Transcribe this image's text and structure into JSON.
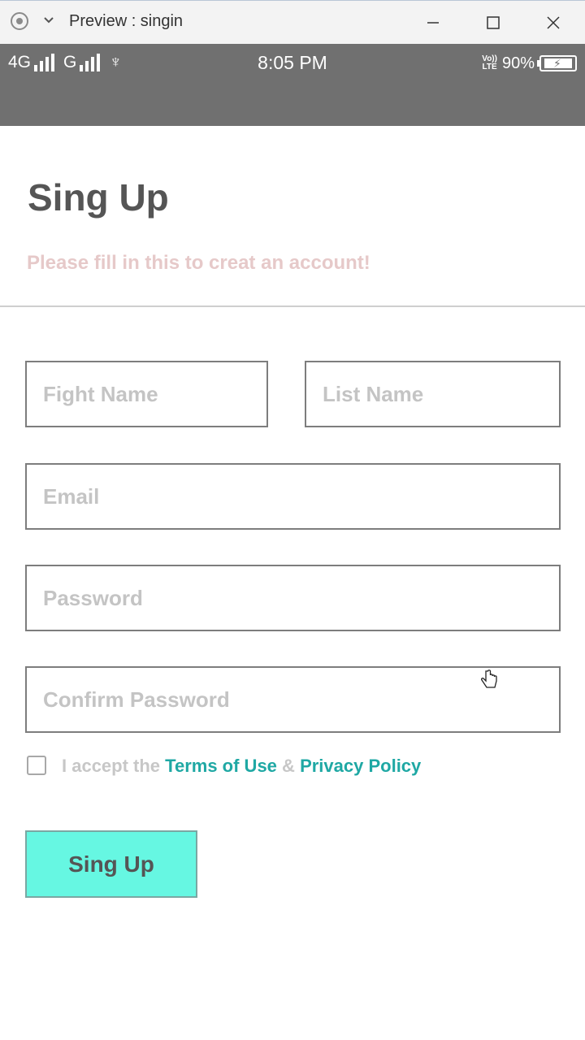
{
  "window": {
    "title": "Preview : singin",
    "icons": [
      "record-icon",
      "chevron-down-icon",
      "minimize-icon",
      "maximize-icon",
      "close-icon"
    ]
  },
  "status_bar": {
    "network1": "4G",
    "network2": "G",
    "time": "8:05 PM",
    "volte_top": "Vo))",
    "volte_bottom": "LTE",
    "battery": "90%"
  },
  "form": {
    "title": "Sing Up",
    "subtitle": "Please fill in this to creat an account!",
    "first_name_placeholder": "Fight Name",
    "last_name_placeholder": "List Name",
    "email_placeholder": "Email",
    "password_placeholder": "Password",
    "confirm_password_placeholder": "Confirm Password",
    "accept_prefix": "I accept the",
    "terms_link": "Terms of Use",
    "ampersand": "&",
    "privacy_link": "Privacy Policy",
    "submit_label": "Sing Up"
  },
  "colors": {
    "status_bar": "#707070",
    "button_bg": "#66f7e2",
    "link": "#1fa8a4",
    "subtitle": "#e6c9c9"
  }
}
